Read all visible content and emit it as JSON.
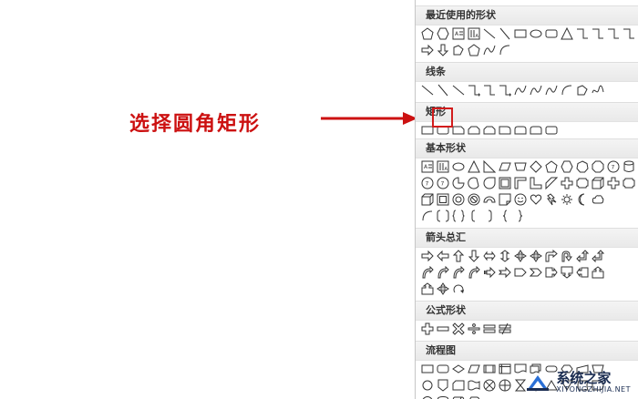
{
  "annotation": {
    "text": "选择圆角矩形",
    "color": "#cc1111"
  },
  "panel": {
    "sections": [
      {
        "key": "recent",
        "title": "最近使用的形状"
      },
      {
        "key": "lines",
        "title": "线条"
      },
      {
        "key": "rects",
        "title": "矩形"
      },
      {
        "key": "basic",
        "title": "基本形状"
      },
      {
        "key": "arrows",
        "title": "箭头总汇"
      },
      {
        "key": "formula",
        "title": "公式形状"
      },
      {
        "key": "flow",
        "title": "流程图"
      }
    ]
  },
  "watermark": {
    "cn": "系统之家",
    "en": "XITONGZHIJIA.NET"
  }
}
